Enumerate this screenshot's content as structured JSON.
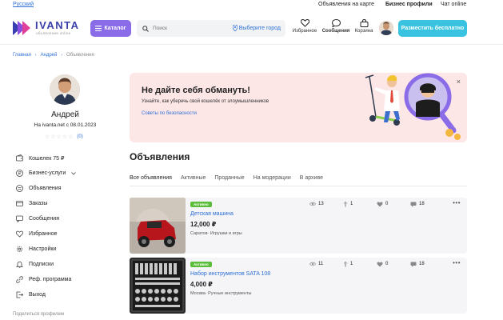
{
  "topbar": {
    "language": "Русский",
    "links": [
      "Объявления на карте",
      "Бизнес профили",
      "Чат online"
    ]
  },
  "header": {
    "logo_text": "IVANTA",
    "logo_sub": "объявления online",
    "catalog_label": "Каталог",
    "search_placeholder": "Поиск",
    "city_label": "Выберите город",
    "favorites_label": "Избранное",
    "messages_label": "Сообщения",
    "cart_label": "Корзина",
    "cta_label": "Разместить бесплатно"
  },
  "breadcrumb": [
    "Главная",
    "Андрей",
    "Объявления"
  ],
  "profile": {
    "name": "Андрей",
    "since": "На ivanta.net с 08.01.2023",
    "stars": "☆☆☆☆☆",
    "review_count": "(0)"
  },
  "menu": [
    {
      "label": "Кошелек 75 ₽",
      "icon": "wallet-icon"
    },
    {
      "label": "Бизнес-услуги",
      "icon": "ruble-icon"
    },
    {
      "label": "Объявления",
      "icon": "list-icon"
    },
    {
      "label": "Заказы",
      "icon": "orders-icon"
    },
    {
      "label": "Сообщения",
      "icon": "chat-icon"
    },
    {
      "label": "Избранное",
      "icon": "heart-icon"
    },
    {
      "label": "Настройки",
      "icon": "gear-icon"
    },
    {
      "label": "Подписки",
      "icon": "bell-icon"
    },
    {
      "label": "Реф. программа",
      "icon": "link-icon"
    },
    {
      "label": "Выход",
      "icon": "logout-icon"
    }
  ],
  "share_label": "Поделиться профилем",
  "banner": {
    "title": "Не дайте себя обмануть!",
    "text": "Узнайте, как уберечь свой кошелёк от злоумышленников",
    "link": "Советы по безопасности",
    "close": "×"
  },
  "listings": {
    "title": "Объявления",
    "tabs": [
      "Все объявления",
      "Активные",
      "Проданные",
      "На модерации",
      "В архиве"
    ],
    "items": [
      {
        "badge": "Активно",
        "title": "Детская машина",
        "price": "12,000 ₽",
        "location": "Саратов· Игрушки и игры",
        "stats": [
          "13",
          "1",
          "0",
          "18"
        ]
      },
      {
        "badge": "Активно",
        "title": "Набор инструментов SATA 108",
        "price": "4,000 ₽",
        "location": "Москва· Ручные инструменты",
        "stats": [
          "11",
          "1",
          "0",
          "18"
        ]
      }
    ]
  },
  "colors": {
    "accent_purple": "#8a6be8",
    "accent_cyan": "#3ac3e0",
    "link_blue": "#2d6fd6",
    "badge_green": "#5bbd3a",
    "banner_bg": "#fde6e6"
  }
}
